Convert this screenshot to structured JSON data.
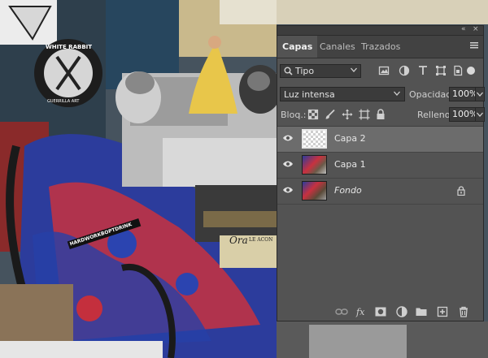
{
  "window": {
    "collapse": "«",
    "close": "×"
  },
  "tabs": [
    {
      "label": "Capas",
      "active": true
    },
    {
      "label": "Canales",
      "active": false
    },
    {
      "label": "Trazados",
      "active": false
    }
  ],
  "filter": {
    "kind": "Tipo"
  },
  "blend": {
    "mode": "Luz intensa"
  },
  "opacity": {
    "label": "Opacidad:",
    "value": "100%"
  },
  "lock": {
    "label": "Bloq.:"
  },
  "fill": {
    "label": "Relleno:",
    "value": "100%"
  },
  "layers": [
    {
      "name": "Capa 2",
      "selected": true,
      "italic": false,
      "locked": false
    },
    {
      "name": "Capa 1",
      "selected": false,
      "italic": false,
      "locked": false
    },
    {
      "name": "Fondo",
      "selected": false,
      "italic": true,
      "locked": true
    }
  ],
  "collage_text": {
    "sticker": "HARDWORKBOPTDRINK",
    "badge": "WHITE RABBIT",
    "badge_sub": "GUERRILLA ART",
    "sign": "Ora",
    "sign_sub": "LE ACON"
  },
  "colors": {
    "panel": "#535353",
    "tabbar": "#424242",
    "selected_row": "#6c6c6c",
    "field": "#3b3b3b"
  }
}
